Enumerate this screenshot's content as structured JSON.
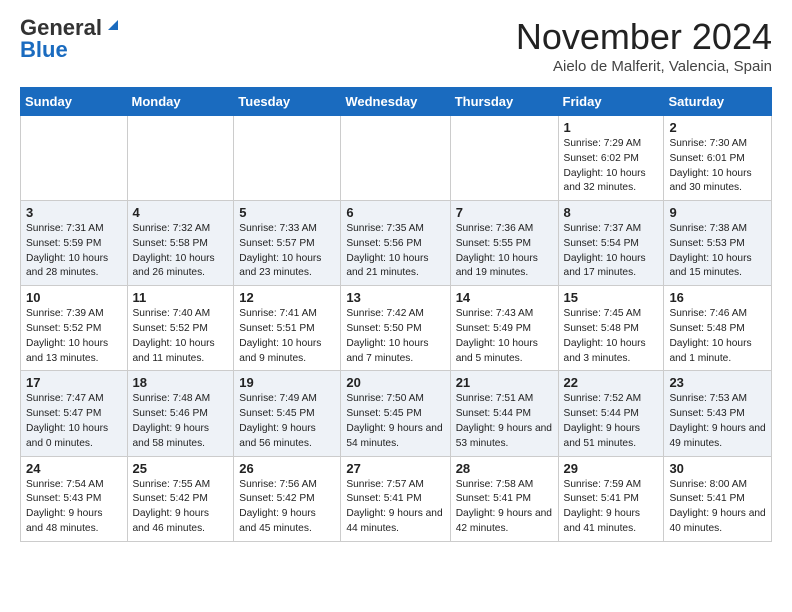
{
  "logo": {
    "general": "General",
    "blue": "Blue"
  },
  "title": {
    "month": "November 2024",
    "location": "Aielo de Malferit, Valencia, Spain"
  },
  "weekdays": [
    "Sunday",
    "Monday",
    "Tuesday",
    "Wednesday",
    "Thursday",
    "Friday",
    "Saturday"
  ],
  "weeks": [
    [
      {
        "day": "",
        "detail": ""
      },
      {
        "day": "",
        "detail": ""
      },
      {
        "day": "",
        "detail": ""
      },
      {
        "day": "",
        "detail": ""
      },
      {
        "day": "",
        "detail": ""
      },
      {
        "day": "1",
        "detail": "Sunrise: 7:29 AM\nSunset: 6:02 PM\nDaylight: 10 hours and 32 minutes."
      },
      {
        "day": "2",
        "detail": "Sunrise: 7:30 AM\nSunset: 6:01 PM\nDaylight: 10 hours and 30 minutes."
      }
    ],
    [
      {
        "day": "3",
        "detail": "Sunrise: 7:31 AM\nSunset: 5:59 PM\nDaylight: 10 hours and 28 minutes."
      },
      {
        "day": "4",
        "detail": "Sunrise: 7:32 AM\nSunset: 5:58 PM\nDaylight: 10 hours and 26 minutes."
      },
      {
        "day": "5",
        "detail": "Sunrise: 7:33 AM\nSunset: 5:57 PM\nDaylight: 10 hours and 23 minutes."
      },
      {
        "day": "6",
        "detail": "Sunrise: 7:35 AM\nSunset: 5:56 PM\nDaylight: 10 hours and 21 minutes."
      },
      {
        "day": "7",
        "detail": "Sunrise: 7:36 AM\nSunset: 5:55 PM\nDaylight: 10 hours and 19 minutes."
      },
      {
        "day": "8",
        "detail": "Sunrise: 7:37 AM\nSunset: 5:54 PM\nDaylight: 10 hours and 17 minutes."
      },
      {
        "day": "9",
        "detail": "Sunrise: 7:38 AM\nSunset: 5:53 PM\nDaylight: 10 hours and 15 minutes."
      }
    ],
    [
      {
        "day": "10",
        "detail": "Sunrise: 7:39 AM\nSunset: 5:52 PM\nDaylight: 10 hours and 13 minutes."
      },
      {
        "day": "11",
        "detail": "Sunrise: 7:40 AM\nSunset: 5:52 PM\nDaylight: 10 hours and 11 minutes."
      },
      {
        "day": "12",
        "detail": "Sunrise: 7:41 AM\nSunset: 5:51 PM\nDaylight: 10 hours and 9 minutes."
      },
      {
        "day": "13",
        "detail": "Sunrise: 7:42 AM\nSunset: 5:50 PM\nDaylight: 10 hours and 7 minutes."
      },
      {
        "day": "14",
        "detail": "Sunrise: 7:43 AM\nSunset: 5:49 PM\nDaylight: 10 hours and 5 minutes."
      },
      {
        "day": "15",
        "detail": "Sunrise: 7:45 AM\nSunset: 5:48 PM\nDaylight: 10 hours and 3 minutes."
      },
      {
        "day": "16",
        "detail": "Sunrise: 7:46 AM\nSunset: 5:48 PM\nDaylight: 10 hours and 1 minute."
      }
    ],
    [
      {
        "day": "17",
        "detail": "Sunrise: 7:47 AM\nSunset: 5:47 PM\nDaylight: 10 hours and 0 minutes."
      },
      {
        "day": "18",
        "detail": "Sunrise: 7:48 AM\nSunset: 5:46 PM\nDaylight: 9 hours and 58 minutes."
      },
      {
        "day": "19",
        "detail": "Sunrise: 7:49 AM\nSunset: 5:45 PM\nDaylight: 9 hours and 56 minutes."
      },
      {
        "day": "20",
        "detail": "Sunrise: 7:50 AM\nSunset: 5:45 PM\nDaylight: 9 hours and 54 minutes."
      },
      {
        "day": "21",
        "detail": "Sunrise: 7:51 AM\nSunset: 5:44 PM\nDaylight: 9 hours and 53 minutes."
      },
      {
        "day": "22",
        "detail": "Sunrise: 7:52 AM\nSunset: 5:44 PM\nDaylight: 9 hours and 51 minutes."
      },
      {
        "day": "23",
        "detail": "Sunrise: 7:53 AM\nSunset: 5:43 PM\nDaylight: 9 hours and 49 minutes."
      }
    ],
    [
      {
        "day": "24",
        "detail": "Sunrise: 7:54 AM\nSunset: 5:43 PM\nDaylight: 9 hours and 48 minutes."
      },
      {
        "day": "25",
        "detail": "Sunrise: 7:55 AM\nSunset: 5:42 PM\nDaylight: 9 hours and 46 minutes."
      },
      {
        "day": "26",
        "detail": "Sunrise: 7:56 AM\nSunset: 5:42 PM\nDaylight: 9 hours and 45 minutes."
      },
      {
        "day": "27",
        "detail": "Sunrise: 7:57 AM\nSunset: 5:41 PM\nDaylight: 9 hours and 44 minutes."
      },
      {
        "day": "28",
        "detail": "Sunrise: 7:58 AM\nSunset: 5:41 PM\nDaylight: 9 hours and 42 minutes."
      },
      {
        "day": "29",
        "detail": "Sunrise: 7:59 AM\nSunset: 5:41 PM\nDaylight: 9 hours and 41 minutes."
      },
      {
        "day": "30",
        "detail": "Sunrise: 8:00 AM\nSunset: 5:41 PM\nDaylight: 9 hours and 40 minutes."
      }
    ]
  ]
}
